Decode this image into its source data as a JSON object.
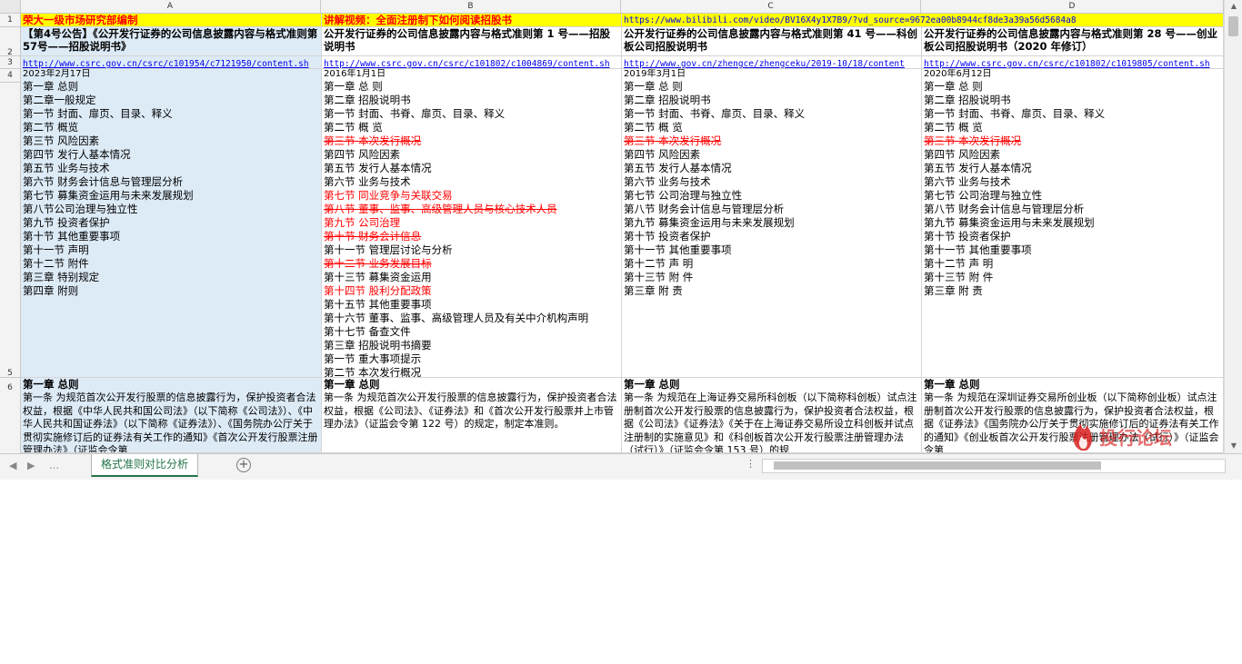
{
  "sheet": {
    "tab": "格式准则对比分析"
  },
  "columns": [
    "A",
    "B",
    "C",
    "D"
  ],
  "rows": [
    "1",
    "2",
    "3",
    "4",
    "5",
    "6"
  ],
  "row1": {
    "a": "荣大一级市场研究部编制",
    "b": "讲解视频：全面注册制下如何阅读招股书",
    "c": "https://www.bilibili.com/video/BV16X4y1X7B9/?vd_source=9672ea00b8944cf8de3a39a56d5684a8"
  },
  "row2": {
    "a": "【第4号公告】《公开发行证券的公司信息披露内容与格式准则第57号——招股说明书》",
    "b": "公开发行证券的公司信息披露内容与格式准则第 1 号——招股说明书",
    "c": "公开发行证券的公司信息披露内容与格式准则第 41 号——科创板公司招股说明书",
    "d": "公开发行证券的公司信息披露内容与格式准则第 28 号——创业板公司招股说明书（2020 年修订）"
  },
  "row3": {
    "a": "http://www.csrc.gov.cn/csrc/c101954/c7121950/content.sh",
    "b": "http://www.csrc.gov.cn/csrc/c101802/c1004869/content.sh",
    "c": "http://www.gov.cn/zhengce/zhengceku/2019-10/18/content",
    "d": "http://www.csrc.gov.cn/csrc/c101802/c1019805/content.sh"
  },
  "row4": {
    "a": {
      "date": "2023年2月17日",
      "items": [
        {
          "t": "第一章 总则"
        },
        {
          "t": "第二章一般规定"
        },
        {
          "t": "第一节 封面、扉页、目录、释义"
        },
        {
          "t": "第二节 概览"
        },
        {
          "t": "第三节 风险因素"
        },
        {
          "t": "第四节 发行人基本情况"
        },
        {
          "t": "第五节 业务与技术"
        },
        {
          "t": "第六节 财务会计信息与管理层分析"
        },
        {
          "t": "第七节 募集资金运用与未来发展规划"
        },
        {
          "t": "第八节公司治理与独立性"
        },
        {
          "t": "第九节 投资者保护"
        },
        {
          "t": "第十节 其他重要事项"
        },
        {
          "t": "第十一节 声明"
        },
        {
          "t": "第十二节 附件"
        },
        {
          "t": "第三章 特别规定"
        },
        {
          "t": "第四章 附则"
        }
      ]
    },
    "b": {
      "date": "2016年1月1日",
      "items": [
        {
          "t": "第一章 总 则"
        },
        {
          "t": "第二章 招股说明书"
        },
        {
          "t": "第一节 封面、书脊、扉页、目录、释义"
        },
        {
          "t": "第二节 概 览"
        },
        {
          "t": "第三节 本次发行概况",
          "s": "del"
        },
        {
          "t": "第四节 风险因素"
        },
        {
          "t": "第五节 发行人基本情况"
        },
        {
          "t": "第六节 业务与技术"
        },
        {
          "t": "第七节 同业竞争与关联交易",
          "s": "red"
        },
        {
          "t": "第八节 董事、监事、高级管理人员与核心技术人员",
          "s": "del"
        },
        {
          "t": "第九节 公司治理",
          "s": "red"
        },
        {
          "t": "第十节 财务会计信息",
          "s": "del"
        },
        {
          "t": "第十一节 管理层讨论与分析"
        },
        {
          "t": "第十二节 业务发展目标",
          "s": "del"
        },
        {
          "t": "第十三节 募集资金运用"
        },
        {
          "t": "第十四节 股利分配政策",
          "s": "red"
        },
        {
          "t": "第十五节 其他重要事项"
        },
        {
          "t": "第十六节 董事、监事、高级管理人员及有关中介机构声明"
        },
        {
          "t": "第十七节 备查文件"
        },
        {
          "t": "第三章 招股说明书摘要"
        },
        {
          "t": "第一节 重大事项提示"
        },
        {
          "t": "第二节 本次发行概况"
        }
      ]
    },
    "c": {
      "date": "2019年3月1日",
      "items": [
        {
          "t": "第一章 总 则"
        },
        {
          "t": "第二章 招股说明书"
        },
        {
          "t": "第一节 封面、书脊、扉页、目录、释义"
        },
        {
          "t": "第二节 概 览"
        },
        {
          "t": "第三节 本次发行概况",
          "s": "del"
        },
        {
          "t": "第四节 风险因素"
        },
        {
          "t": "第五节 发行人基本情况"
        },
        {
          "t": "第六节 业务与技术"
        },
        {
          "t": "第七节 公司治理与独立性"
        },
        {
          "t": "第八节 财务会计信息与管理层分析"
        },
        {
          "t": "第九节 募集资金运用与未来发展规划"
        },
        {
          "t": "第十节 投资者保护"
        },
        {
          "t": "第十一节 其他重要事项"
        },
        {
          "t": "第十二节 声 明"
        },
        {
          "t": "第十三节 附 件"
        },
        {
          "t": "第三章 附 责"
        }
      ]
    },
    "d": {
      "date": "2020年6月12日",
      "items": [
        {
          "t": "第一章 总 则"
        },
        {
          "t": "第二章 招股说明书"
        },
        {
          "t": "第一节 封面、书脊、扉页、目录、释义"
        },
        {
          "t": "第二节 概 览"
        },
        {
          "t": "第三节 本次发行概况",
          "s": "del"
        },
        {
          "t": "第四节 风险因素"
        },
        {
          "t": "第五节 发行人基本情况"
        },
        {
          "t": "第六节 业务与技术"
        },
        {
          "t": "第七节 公司治理与独立性"
        },
        {
          "t": "第八节 财务会计信息与管理层分析"
        },
        {
          "t": "第九节 募集资金运用与未来发展规划"
        },
        {
          "t": "第十节 投资者保护"
        },
        {
          "t": "第十一节 其他重要事项"
        },
        {
          "t": "第十二节 声 明"
        },
        {
          "t": "第十三节 附 件"
        },
        {
          "t": "第三章 附 责"
        }
      ]
    }
  },
  "row6": {
    "a": {
      "h": "第一章 总则",
      "body": "第一条 为规范首次公开发行股票的信息披露行为，保护投资者合法权益，根据《中华人民共和国公司法》（以下简称《公司法》）、《中华人民共和国证券法》（以下简称《证券法》）、《国务院办公厅关于贯彻实施修订后的证券法有关工作的通知》《首次公开发行股票注册管理办法》（证监会令第"
    },
    "b": {
      "h": "第一章 总则",
      "body": "第一条 为规范首次公开发行股票的信息披露行为，保护投资者合法权益，根据《公司法》、《证券法》和《首次公开发行股票并上市管理办法》（证监会令第 122 号）的规定，制定本准则。"
    },
    "c": {
      "h": "第一章 总则",
      "body": "第一条 为规范在上海证券交易所科创板（以下简称科创板）试点注册制首次公开发行股票的信息披露行为，保护投资者合法权益，根据《公司法》《证券法》《关于在上海证券交易所设立科创板并试点注册制的实施意见》和《科创板首次公开发行股票注册管理办法（试行）》（证监会令第 153 号）的规"
    },
    "d": {
      "h": "第一章 总则",
      "body": "第一条 为规范在深圳证券交易所创业板（以下简称创业板）试点注册制首次公开发行股票的信息披露行为，保护投资者合法权益，根据《证券法》《国务院办公厅关于贯彻实施修订后的证券法有关工作的通知》《创业板首次公开发行股票注册管理办法（试行）》（证监会令第"
    }
  },
  "watermark": {
    "text": "投行论坛"
  }
}
